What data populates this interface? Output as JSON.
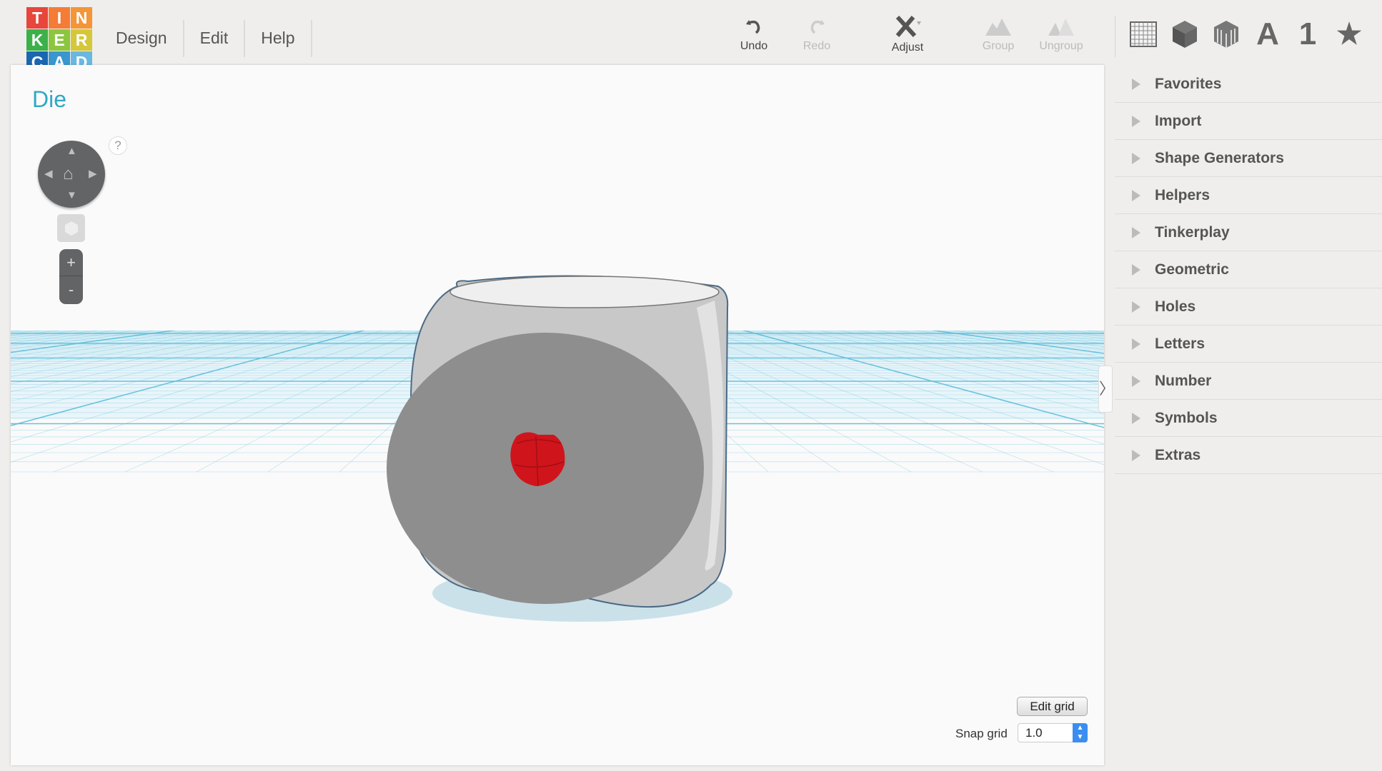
{
  "logo": {
    "letters": [
      "T",
      "I",
      "N",
      "K",
      "E",
      "R",
      "C",
      "A",
      "D"
    ],
    "colors": [
      "#e8453c",
      "#f47c37",
      "#f49537",
      "#3cb04a",
      "#8cc63f",
      "#d4c83a",
      "#1a67b0",
      "#3a96cf",
      "#6ab8e0"
    ]
  },
  "menu": [
    "Design",
    "Edit",
    "Help"
  ],
  "toolbar": {
    "undo": "Undo",
    "redo": "Redo",
    "adjust": "Adjust",
    "group": "Group",
    "ungroup": "Ungroup"
  },
  "view_icons": [
    "grid-icon",
    "solid-cube-icon",
    "striped-cube-icon",
    "letter-a-icon",
    "number-one-icon",
    "star-icon"
  ],
  "view_icon_glyphs": {
    "a": "A",
    "one": "1",
    "star": "★"
  },
  "design_title": "Die",
  "nav": {
    "help": "?",
    "zoom_in": "+",
    "zoom_out": "-"
  },
  "sidebar": [
    "Favorites",
    "Import",
    "Shape Generators",
    "Helpers",
    "Tinkerplay",
    "Geometric",
    "Holes",
    "Letters",
    "Number",
    "Symbols",
    "Extras"
  ],
  "grid": {
    "edit_label": "Edit grid",
    "snap_label": "Snap grid",
    "snap_value": "1.0"
  },
  "colors": {
    "accent": "#2fa8c4",
    "grid": "#5bbcd9",
    "die": "#9a9a9a",
    "pip": "#d0141c"
  }
}
